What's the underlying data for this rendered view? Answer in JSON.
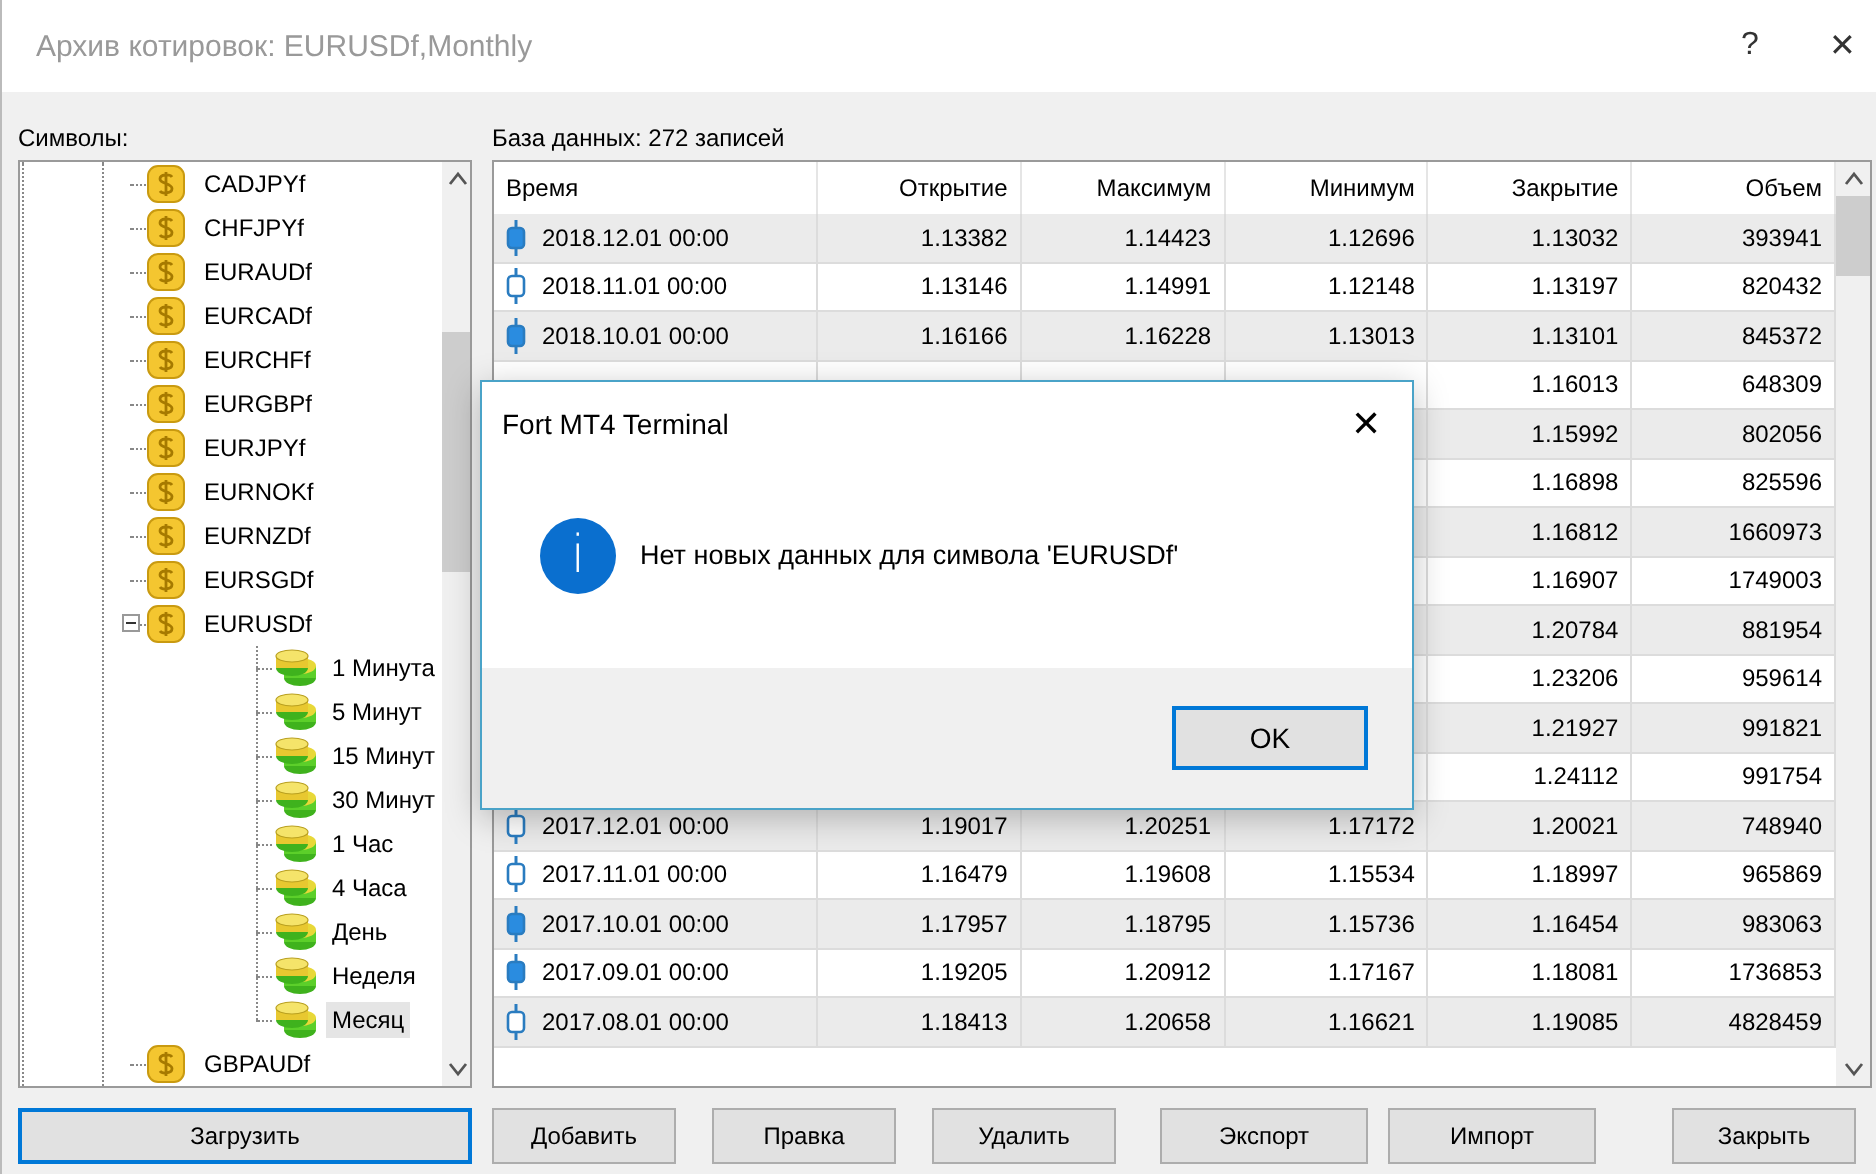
{
  "window": {
    "title": "Архив котировок: EURUSDf,Monthly",
    "help": "?",
    "close": "✕"
  },
  "symbols_label": "Символы:",
  "tree": [
    {
      "label": "CADJPYf",
      "selected": false
    },
    {
      "label": "CHFJPYf",
      "selected": false
    },
    {
      "label": "EURAUDf",
      "selected": false
    },
    {
      "label": "EURCADf",
      "selected": false
    },
    {
      "label": "EURCHFf",
      "selected": false
    },
    {
      "label": "EURGBPf",
      "selected": false
    },
    {
      "label": "EURJPYf",
      "selected": false
    },
    {
      "label": "EURNOKf",
      "selected": false
    },
    {
      "label": "EURNZDf",
      "selected": false
    },
    {
      "label": "EURSGDf",
      "selected": false
    },
    {
      "label": "EURUSDf",
      "expanded": true,
      "selected": false,
      "children": [
        {
          "label": "1 Минута",
          "selected": false
        },
        {
          "label": "5 Минут",
          "selected": false
        },
        {
          "label": "15 Минут",
          "selected": false
        },
        {
          "label": "30 Минут",
          "selected": false
        },
        {
          "label": "1 Час",
          "selected": false
        },
        {
          "label": "4 Часа",
          "selected": false
        },
        {
          "label": "День",
          "selected": false
        },
        {
          "label": "Неделя",
          "selected": false
        },
        {
          "label": "Месяц",
          "selected": true
        }
      ]
    },
    {
      "label": "GBPAUDf",
      "selected": false
    }
  ],
  "database_label": "База данных: 272 записей",
  "table": {
    "columns": [
      "Время",
      "Открытие",
      "Максимум",
      "Минимум",
      "Закрытие",
      "Объем"
    ],
    "rows": [
      {
        "candle_filled": true,
        "cells": [
          "2018.12.01 00:00",
          "1.13382",
          "1.14423",
          "1.12696",
          "1.13032",
          "393941"
        ]
      },
      {
        "candle_filled": false,
        "cells": [
          "2018.11.01 00:00",
          "1.13146",
          "1.14991",
          "1.12148",
          "1.13197",
          "820432"
        ]
      },
      {
        "candle_filled": true,
        "cells": [
          "2018.10.01 00:00",
          "1.16166",
          "1.16228",
          "1.13013",
          "1.13101",
          "845372"
        ]
      },
      {
        "cells": [
          "1.16013",
          "648309"
        ]
      },
      {
        "cells": [
          "1.15992",
          "802056"
        ]
      },
      {
        "cells": [
          "1.16898",
          "825596"
        ]
      },
      {
        "cells": [
          "1.16812",
          "1660973"
        ]
      },
      {
        "cells": [
          "1.16907",
          "1749003"
        ]
      },
      {
        "cells": [
          "1.20784",
          "881954"
        ]
      },
      {
        "cells": [
          "1.23206",
          "959614"
        ]
      },
      {
        "cells": [
          "1.21927",
          "991821"
        ]
      },
      {
        "cells": [
          "1.24112",
          "991754"
        ]
      },
      {
        "candle_filled": false,
        "cells": [
          "2017.12.01 00:00",
          "1.19017",
          "1.20251",
          "1.17172",
          "1.20021",
          "748940"
        ]
      },
      {
        "candle_filled": false,
        "cells": [
          "2017.11.01 00:00",
          "1.16479",
          "1.19608",
          "1.15534",
          "1.18997",
          "965869"
        ]
      },
      {
        "candle_filled": true,
        "cells": [
          "2017.10.01 00:00",
          "1.17957",
          "1.18795",
          "1.15736",
          "1.16454",
          "983063"
        ]
      },
      {
        "candle_filled": true,
        "cells": [
          "2017.09.01 00:00",
          "1.19205",
          "1.20912",
          "1.17167",
          "1.18081",
          "1736853"
        ]
      },
      {
        "candle_filled": false,
        "cells": [
          "2017.08.01 00:00",
          "1.18413",
          "1.20658",
          "1.16621",
          "1.19085",
          "4828459"
        ]
      }
    ]
  },
  "buttons": [
    {
      "label": "Загрузить",
      "focused": true
    },
    {
      "label": "Добавить",
      "focused": false
    },
    {
      "label": "Правка",
      "focused": false
    },
    {
      "label": "Удалить",
      "focused": false
    },
    {
      "label": "Экспорт",
      "focused": false
    },
    {
      "label": "Импорт",
      "focused": false
    },
    {
      "label": "Закрыть",
      "focused": false
    }
  ],
  "dialog": {
    "title": "Fort MT4 Terminal",
    "close": "✕",
    "icon_text": "i",
    "message": "Нет новых данных для символа 'EURUSDf'",
    "button": {
      "label": "OK",
      "focused": true
    }
  }
}
